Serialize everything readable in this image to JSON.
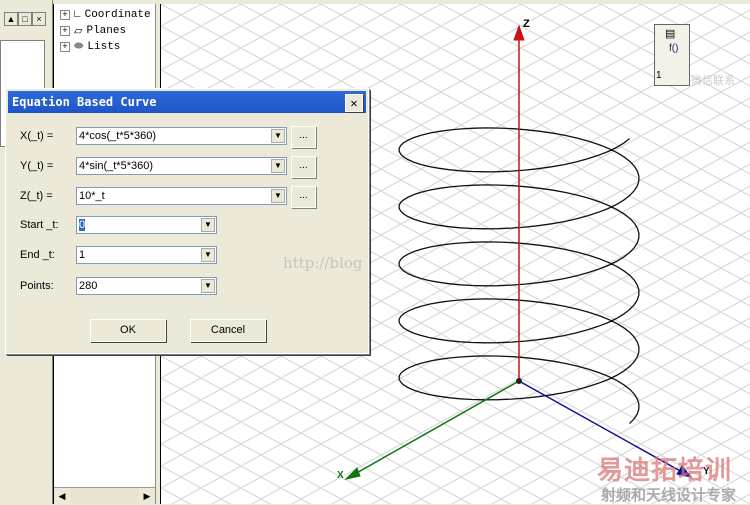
{
  "window_controls": {
    "minimize": "▲",
    "maximize": "□",
    "close": "×"
  },
  "tree": {
    "items": [
      {
        "label": "Coordinate",
        "icon": "axes-icon"
      },
      {
        "label": "Planes",
        "icon": "planes-icon"
      },
      {
        "label": "Lists",
        "icon": "lists-icon"
      }
    ]
  },
  "dialog": {
    "title": "Equation Based Curve",
    "close": "✕",
    "fields": [
      {
        "label": "X(_t) =",
        "value": "4*cos(_t*5*360)"
      },
      {
        "label": "Y(_t) =",
        "value": "4*sin(_t*5*360)"
      },
      {
        "label": "Z(_t) =",
        "value": "10*_t"
      },
      {
        "label": "Start _t:",
        "value": "0"
      },
      {
        "label": "End _t:",
        "value": "1"
      },
      {
        "label": "Points:",
        "value": "280"
      }
    ],
    "ellipsis": "...",
    "ok": "OK",
    "cancel": "Cancel"
  },
  "viewport": {
    "z_label": "Z",
    "y_label": "Y",
    "x_label": "X",
    "thumb_label": "1",
    "colors": {
      "z": "#cc1111",
      "x": "#117711",
      "y": "#111199"
    }
  },
  "watermark": {
    "url": "http://blog",
    "wechat": "微信联系",
    "brand": "易迪拓培训",
    "tagline": "射频和天线设计专家"
  }
}
